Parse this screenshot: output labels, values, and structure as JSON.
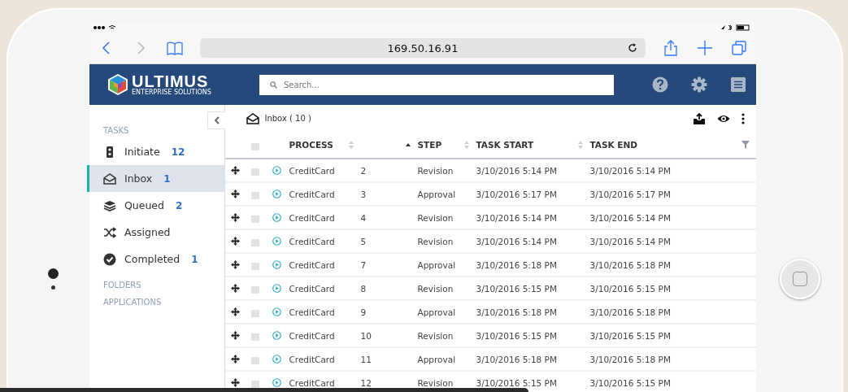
{
  "browser": {
    "url": "169.50.16.91"
  },
  "header": {
    "logo_name": "ULTIMUS",
    "logo_tagline": "ENTERPRISE SOLUTIONS",
    "search": {
      "placeholder": "Search..."
    }
  },
  "sidebar": {
    "sections": [
      {
        "title": "TASKS",
        "items": [
          {
            "kind": "initiate",
            "label": "Initiate",
            "count": "12",
            "selected": false
          },
          {
            "kind": "inbox",
            "label": "Inbox",
            "count": "1",
            "selected": true
          },
          {
            "kind": "queued",
            "label": "Queued",
            "count": "2",
            "selected": false
          },
          {
            "kind": "assigned",
            "label": "Assigned",
            "selected": false
          },
          {
            "kind": "completed",
            "label": "Completed",
            "count": "1",
            "selected": false
          }
        ]
      },
      {
        "title": "FOLDERS"
      },
      {
        "title": "APPLICATIONS"
      }
    ]
  },
  "content": {
    "title": "Inbox ( 10 )",
    "table": {
      "columns": [
        "PROCESS",
        "STEP",
        "TASK START",
        "TASK END"
      ],
      "header_checked": false,
      "rows": [
        {
          "checked": false,
          "process": "CreditCard",
          "column_2": "2",
          "step": "Revision",
          "task_start": "3/10/2016 5:14 PM",
          "task_end": "3/10/2016 5:14 PM"
        },
        {
          "checked": false,
          "process": "CreditCard",
          "column_2": "3",
          "step": "Approval",
          "task_start": "3/10/2016 5:17 PM",
          "task_end": "3/10/2016 5:17 PM"
        },
        {
          "checked": false,
          "process": "CreditCard",
          "column_2": "4",
          "step": "Revision",
          "task_start": "3/10/2016 5:14 PM",
          "task_end": "3/10/2016 5:14 PM"
        },
        {
          "checked": false,
          "process": "CreditCard",
          "column_2": "5",
          "step": "Revision",
          "task_start": "3/10/2016 5:14 PM",
          "task_end": "3/10/2016 5:14 PM"
        },
        {
          "checked": false,
          "process": "CreditCard",
          "column_2": "7",
          "step": "Approval",
          "task_start": "3/10/2016 5:18 PM",
          "task_end": "3/10/2016 5:18 PM"
        },
        {
          "checked": false,
          "process": "CreditCard",
          "column_2": "8",
          "step": "Revision",
          "task_start": "3/10/2016 5:15 PM",
          "task_end": "3/10/2016 5:15 PM"
        },
        {
          "checked": false,
          "process": "CreditCard",
          "column_2": "9",
          "step": "Approval",
          "task_start": "3/10/2016 5:18 PM",
          "task_end": "3/10/2016 5:18 PM"
        },
        {
          "checked": false,
          "process": "CreditCard",
          "column_2": "10",
          "step": "Revision",
          "task_start": "3/10/2016 5:15 PM",
          "task_end": "3/10/2016 5:15 PM"
        },
        {
          "checked": false,
          "process": "CreditCard",
          "column_2": "11",
          "step": "Approval",
          "task_start": "3/10/2016 5:18 PM",
          "task_end": "3/10/2016 5:18 PM"
        },
        {
          "checked": false,
          "process": "CreditCard",
          "column_2": "12",
          "step": "Revision",
          "task_start": "3/10/2016 5:15 PM",
          "task_end": "3/10/2016 5:15 PM"
        }
      ]
    }
  }
}
